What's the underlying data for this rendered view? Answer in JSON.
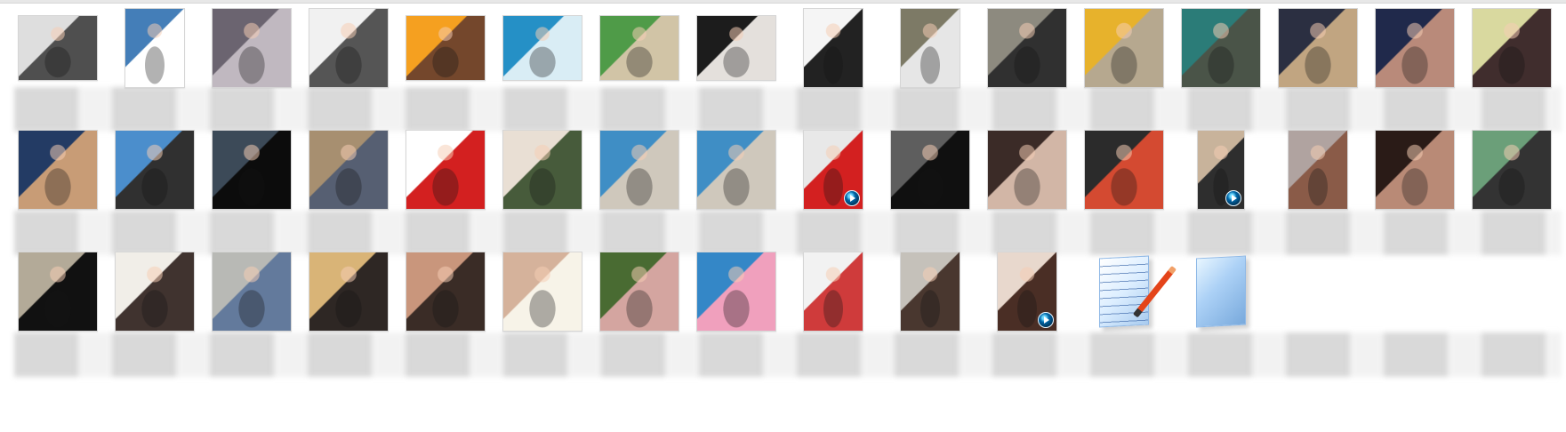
{
  "window": {
    "view": "large-icons-file-list"
  },
  "files": {
    "rows": [
      [
        {
          "kind": "image",
          "shape": "land",
          "colors": [
            "#dedede",
            "#4f4f4f"
          ],
          "icon": "image-thumbnail"
        },
        {
          "kind": "image",
          "shape": "portrait",
          "colors": [
            "#447eb8",
            "#ffffff"
          ],
          "icon": "image-thumbnail"
        },
        {
          "kind": "image",
          "shape": "square",
          "colors": [
            "#6b6470",
            "#c0b8c0"
          ],
          "icon": "image-thumbnail"
        },
        {
          "kind": "image",
          "shape": "square",
          "colors": [
            "#f1f1f1",
            "#555555"
          ],
          "icon": "image-thumbnail"
        },
        {
          "kind": "image",
          "shape": "land",
          "colors": [
            "#f5a020",
            "#74472c"
          ],
          "icon": "image-thumbnail"
        },
        {
          "kind": "image",
          "shape": "land",
          "colors": [
            "#2590c6",
            "#d9edf5"
          ],
          "icon": "image-thumbnail"
        },
        {
          "kind": "image",
          "shape": "land",
          "colors": [
            "#4f9b48",
            "#d1c4a6"
          ],
          "icon": "image-thumbnail"
        },
        {
          "kind": "image",
          "shape": "land",
          "colors": [
            "#1c1c1c",
            "#e4e0dc"
          ],
          "icon": "image-thumbnail"
        },
        {
          "kind": "image",
          "shape": "portrait",
          "colors": [
            "#f5f5f5",
            "#222222"
          ],
          "icon": "image-thumbnail"
        },
        {
          "kind": "image",
          "shape": "portrait",
          "colors": [
            "#7d7a66",
            "#e6e6e6"
          ],
          "icon": "image-thumbnail"
        },
        {
          "kind": "image",
          "shape": "square",
          "colors": [
            "#8d8a7f",
            "#303030"
          ],
          "icon": "image-thumbnail"
        },
        {
          "kind": "image",
          "shape": "square",
          "colors": [
            "#e7b22c",
            "#b6a88f"
          ],
          "icon": "image-thumbnail"
        },
        {
          "kind": "image",
          "shape": "square",
          "colors": [
            "#2b7c78",
            "#4a5448"
          ],
          "icon": "image-thumbnail"
        },
        {
          "kind": "image",
          "shape": "square",
          "colors": [
            "#2b2f41",
            "#c1a581"
          ],
          "icon": "image-thumbnail"
        },
        {
          "kind": "image",
          "shape": "square",
          "colors": [
            "#20294b",
            "#b98a7a"
          ],
          "icon": "image-thumbnail"
        },
        {
          "kind": "image",
          "shape": "square",
          "colors": [
            "#d9d99f",
            "#402d2d"
          ],
          "icon": "image-thumbnail"
        }
      ],
      [
        {
          "kind": "image",
          "shape": "square",
          "colors": [
            "#233b64",
            "#c89c76"
          ],
          "icon": "image-thumbnail"
        },
        {
          "kind": "image",
          "shape": "square",
          "colors": [
            "#4b8ecc",
            "#303030"
          ],
          "icon": "image-thumbnail"
        },
        {
          "kind": "image",
          "shape": "square",
          "colors": [
            "#3c4a58",
            "#0c0c0c"
          ],
          "icon": "image-thumbnail"
        },
        {
          "kind": "image",
          "shape": "square",
          "colors": [
            "#a78f70",
            "#565f72"
          ],
          "icon": "image-thumbnail"
        },
        {
          "kind": "image",
          "shape": "square",
          "colors": [
            "#ffffff",
            "#d32020"
          ],
          "icon": "image-thumbnail"
        },
        {
          "kind": "image",
          "shape": "square",
          "colors": [
            "#e9dfd4",
            "#475b3b"
          ],
          "icon": "image-thumbnail"
        },
        {
          "kind": "image",
          "shape": "square",
          "colors": [
            "#3f8ec5",
            "#cfc8bc"
          ],
          "icon": "image-thumbnail"
        },
        {
          "kind": "image",
          "shape": "square",
          "colors": [
            "#3f8ec5",
            "#cfc8bc"
          ],
          "icon": "image-thumbnail"
        },
        {
          "kind": "video",
          "shape": "portrait",
          "colors": [
            "#e8e8e8",
            "#d32020"
          ],
          "icon": "video-thumbnail"
        },
        {
          "kind": "image",
          "shape": "square",
          "colors": [
            "#5e5e5e",
            "#101010"
          ],
          "icon": "image-thumbnail"
        },
        {
          "kind": "image",
          "shape": "square",
          "colors": [
            "#3b2b27",
            "#d2b6a6"
          ],
          "icon": "image-thumbnail"
        },
        {
          "kind": "image",
          "shape": "square",
          "colors": [
            "#2b2b2b",
            "#d44a31"
          ],
          "icon": "image-thumbnail"
        },
        {
          "kind": "video",
          "shape": "narrow",
          "colors": [
            "#c8b39b",
            "#2e2e2e"
          ],
          "icon": "video-thumbnail"
        },
        {
          "kind": "image",
          "shape": "portrait",
          "colors": [
            "#b0a3a0",
            "#8a5b48"
          ],
          "icon": "image-thumbnail"
        },
        {
          "kind": "image",
          "shape": "square",
          "colors": [
            "#2a1b17",
            "#b98a76"
          ],
          "icon": "image-thumbnail"
        },
        {
          "kind": "image",
          "shape": "square",
          "colors": [
            "#6b9f79",
            "#333333"
          ],
          "icon": "image-thumbnail"
        }
      ],
      [
        {
          "kind": "image",
          "shape": "square",
          "colors": [
            "#b3aa98",
            "#111111"
          ],
          "icon": "image-thumbnail"
        },
        {
          "kind": "image",
          "shape": "square",
          "colors": [
            "#f1eee8",
            "#40332f"
          ],
          "icon": "image-thumbnail"
        },
        {
          "kind": "image",
          "shape": "square",
          "colors": [
            "#b8b9b5",
            "#637a9c"
          ],
          "icon": "image-thumbnail"
        },
        {
          "kind": "image",
          "shape": "square",
          "colors": [
            "#d9b477",
            "#2e2724"
          ],
          "icon": "image-thumbnail"
        },
        {
          "kind": "image",
          "shape": "square",
          "colors": [
            "#c9967c",
            "#3a2c26"
          ],
          "icon": "image-thumbnail"
        },
        {
          "kind": "image",
          "shape": "square",
          "colors": [
            "#d5b29b",
            "#f7f3e8"
          ],
          "icon": "image-thumbnail"
        },
        {
          "kind": "image",
          "shape": "square",
          "colors": [
            "#496b32",
            "#d4a5a0"
          ],
          "icon": "image-thumbnail"
        },
        {
          "kind": "image",
          "shape": "square",
          "colors": [
            "#3487c7",
            "#f0a0bd"
          ],
          "icon": "image-thumbnail"
        },
        {
          "kind": "image",
          "shape": "portrait",
          "colors": [
            "#f2f2f2",
            "#cf3b3b"
          ],
          "icon": "image-thumbnail"
        },
        {
          "kind": "image",
          "shape": "portrait",
          "colors": [
            "#c5c1ba",
            "#49372f"
          ],
          "icon": "image-thumbnail"
        },
        {
          "kind": "video",
          "shape": "portrait",
          "colors": [
            "#e8d8cd",
            "#4a2e25"
          ],
          "icon": "video-thumbnail"
        },
        {
          "kind": "document",
          "shape": "document",
          "icon": "text-document-icon"
        },
        {
          "kind": "document",
          "shape": "document",
          "icon": "blank-document-icon"
        }
      ]
    ]
  }
}
